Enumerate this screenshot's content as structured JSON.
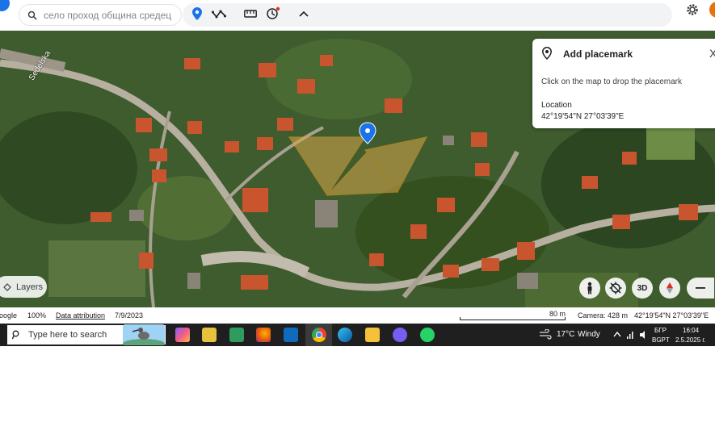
{
  "toolbar": {
    "search_placeholder": "село проход община средец",
    "icons": [
      "search-icon",
      "location-pin-icon",
      "path-icon",
      "ruler-icon",
      "history-icon",
      "chevron-up-icon",
      "gear-icon"
    ]
  },
  "map": {
    "road_label": "Sedelska",
    "placemark_panel": {
      "title": "Add placemark",
      "close_glyph": "X",
      "hint": "Click on the map to drop the placemark",
      "location_label": "Location",
      "location_value": "42°19'54\"N 27°03'39\"E"
    },
    "layers_label": "Layers",
    "view_button_3d": "3D"
  },
  "status_bar": {
    "brand": "oogle",
    "zoom": "100%",
    "data_attribution": "Data attribution",
    "imagery_date": "7/9/2023",
    "scale": "80 m",
    "camera": "Camera: 428 m",
    "coordinates": "42°19'54\"N 27°03'39\"E"
  },
  "taskbar": {
    "search_placeholder": "Type here to search",
    "weather_temp": "17°C",
    "weather_label": "Windy",
    "lang_top": "БГР",
    "lang_bottom": "BGPT",
    "time": "16:04",
    "date": "2.5.2025 г.",
    "colors": {
      "taskbar_bg": "#1f1f1f",
      "accent": "#1a73e8",
      "placemark_orange": "#f5a623"
    }
  }
}
